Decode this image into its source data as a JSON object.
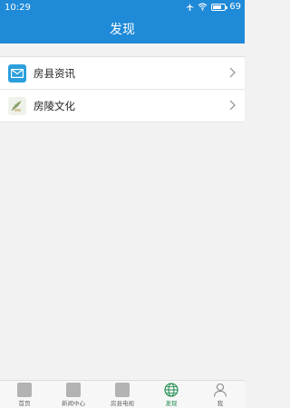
{
  "status_bar": {
    "time": "10:29",
    "battery": "69",
    "battery_level": 0.69
  },
  "header": {
    "title": "发现"
  },
  "list": [
    {
      "label": "房县资讯",
      "icon": "mail-icon"
    },
    {
      "label": "房陵文化",
      "icon": "culture-icon"
    }
  ],
  "bottom_nav": [
    {
      "label": "首页",
      "icon": "home-icon"
    },
    {
      "label": "新闻中心",
      "icon": "news-icon"
    },
    {
      "label": "房县电视",
      "icon": "tv-icon"
    },
    {
      "label": "发现",
      "icon": "globe-icon",
      "active": true
    },
    {
      "label": "我",
      "icon": "person-icon"
    }
  ],
  "colors": {
    "primary": "#1e8ad8",
    "active_tab": "#1b8a4c",
    "background": "#f2f2f2"
  }
}
